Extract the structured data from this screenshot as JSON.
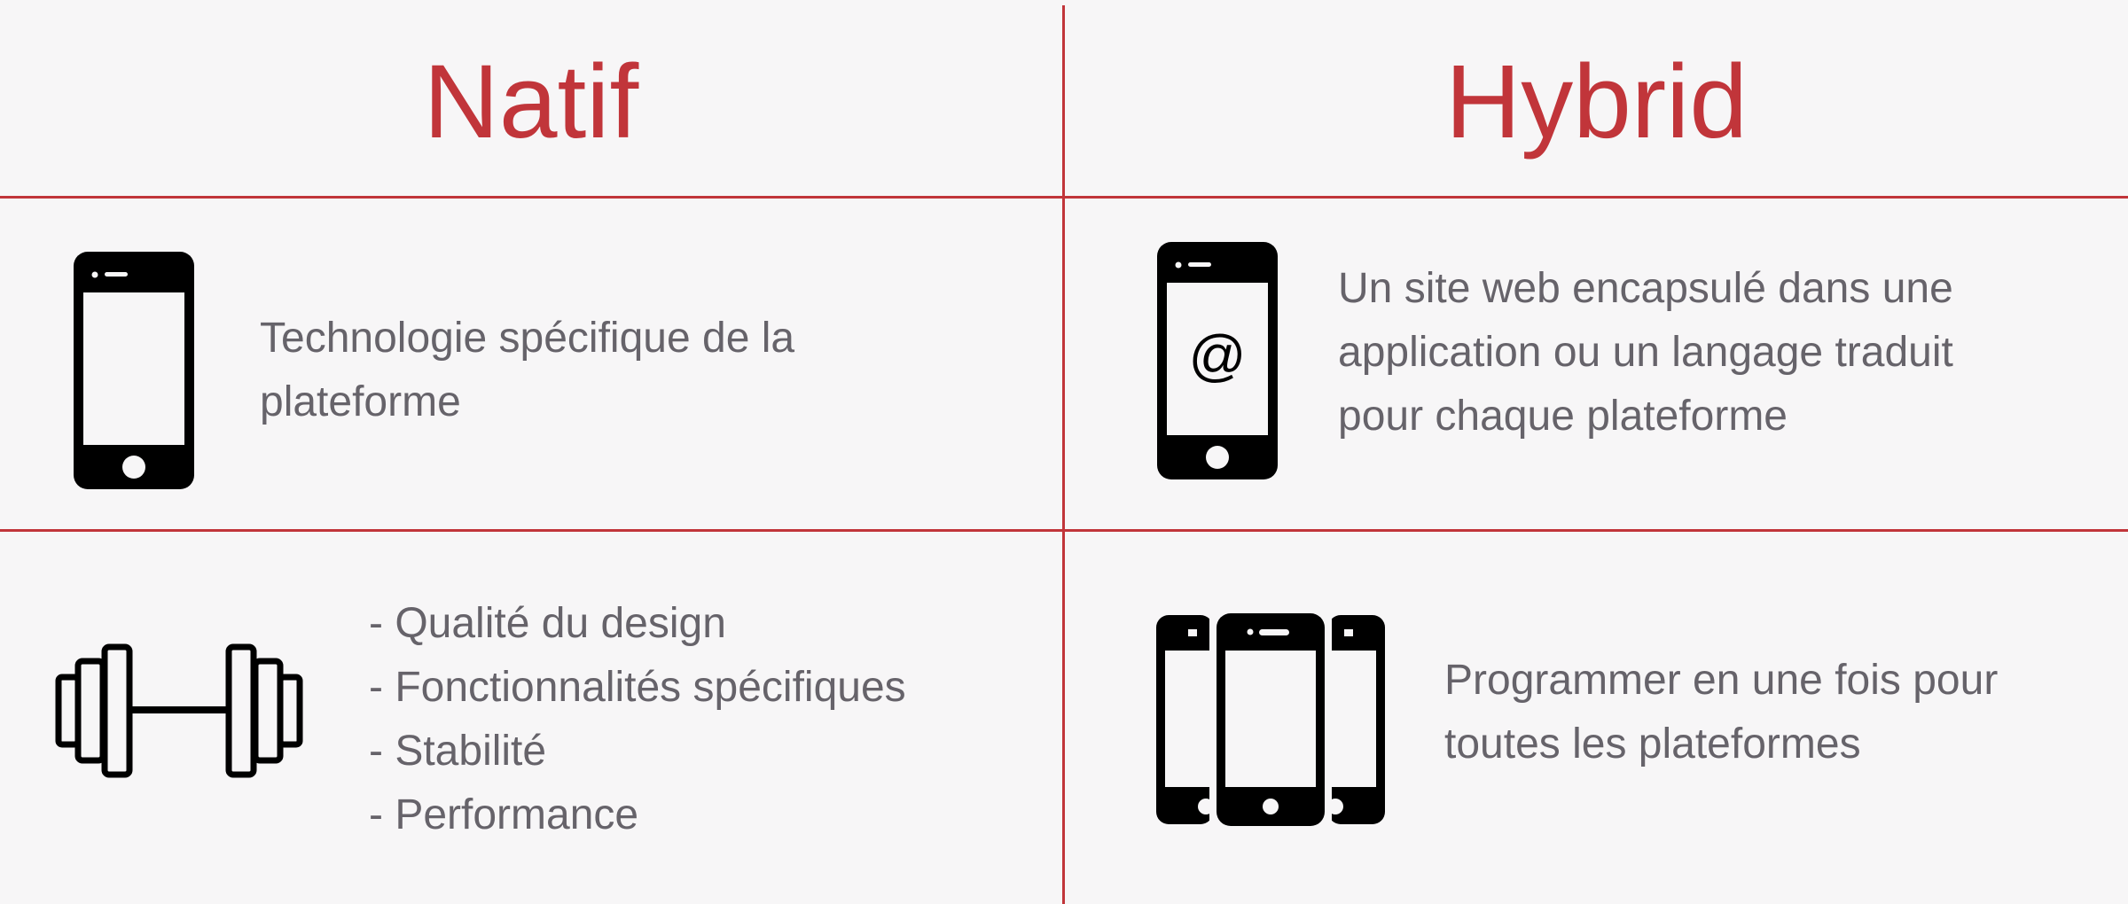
{
  "header": {
    "natif_title": "Natif",
    "hybrid_title": "Hybrid"
  },
  "natif": {
    "technology": {
      "icon": "smartphone-icon",
      "lines": [
        "Technologie spécifique de la",
        "plateforme"
      ]
    },
    "strengths": {
      "icon": "dumbbell-icon",
      "lines": [
        "- Qualité du design",
        "- Fonctionnalités spécifiques",
        "- Stabilité",
        "- Performance"
      ]
    }
  },
  "hybrid": {
    "technology": {
      "icon": "smartphone-web-icon",
      "icon_symbol": "@",
      "lines": [
        "Un site web encapsulé dans une",
        "application ou un langage traduit",
        "pour chaque plateforme"
      ]
    },
    "strengths": {
      "icon": "multiple-smartphones-icon",
      "lines": [
        "Programmer en une fois pour",
        "toutes les plateformes"
      ]
    }
  },
  "colors": {
    "accent": "#c1353a",
    "text": "#66636a",
    "background": "#f7f6f7",
    "icon": "#000000"
  }
}
